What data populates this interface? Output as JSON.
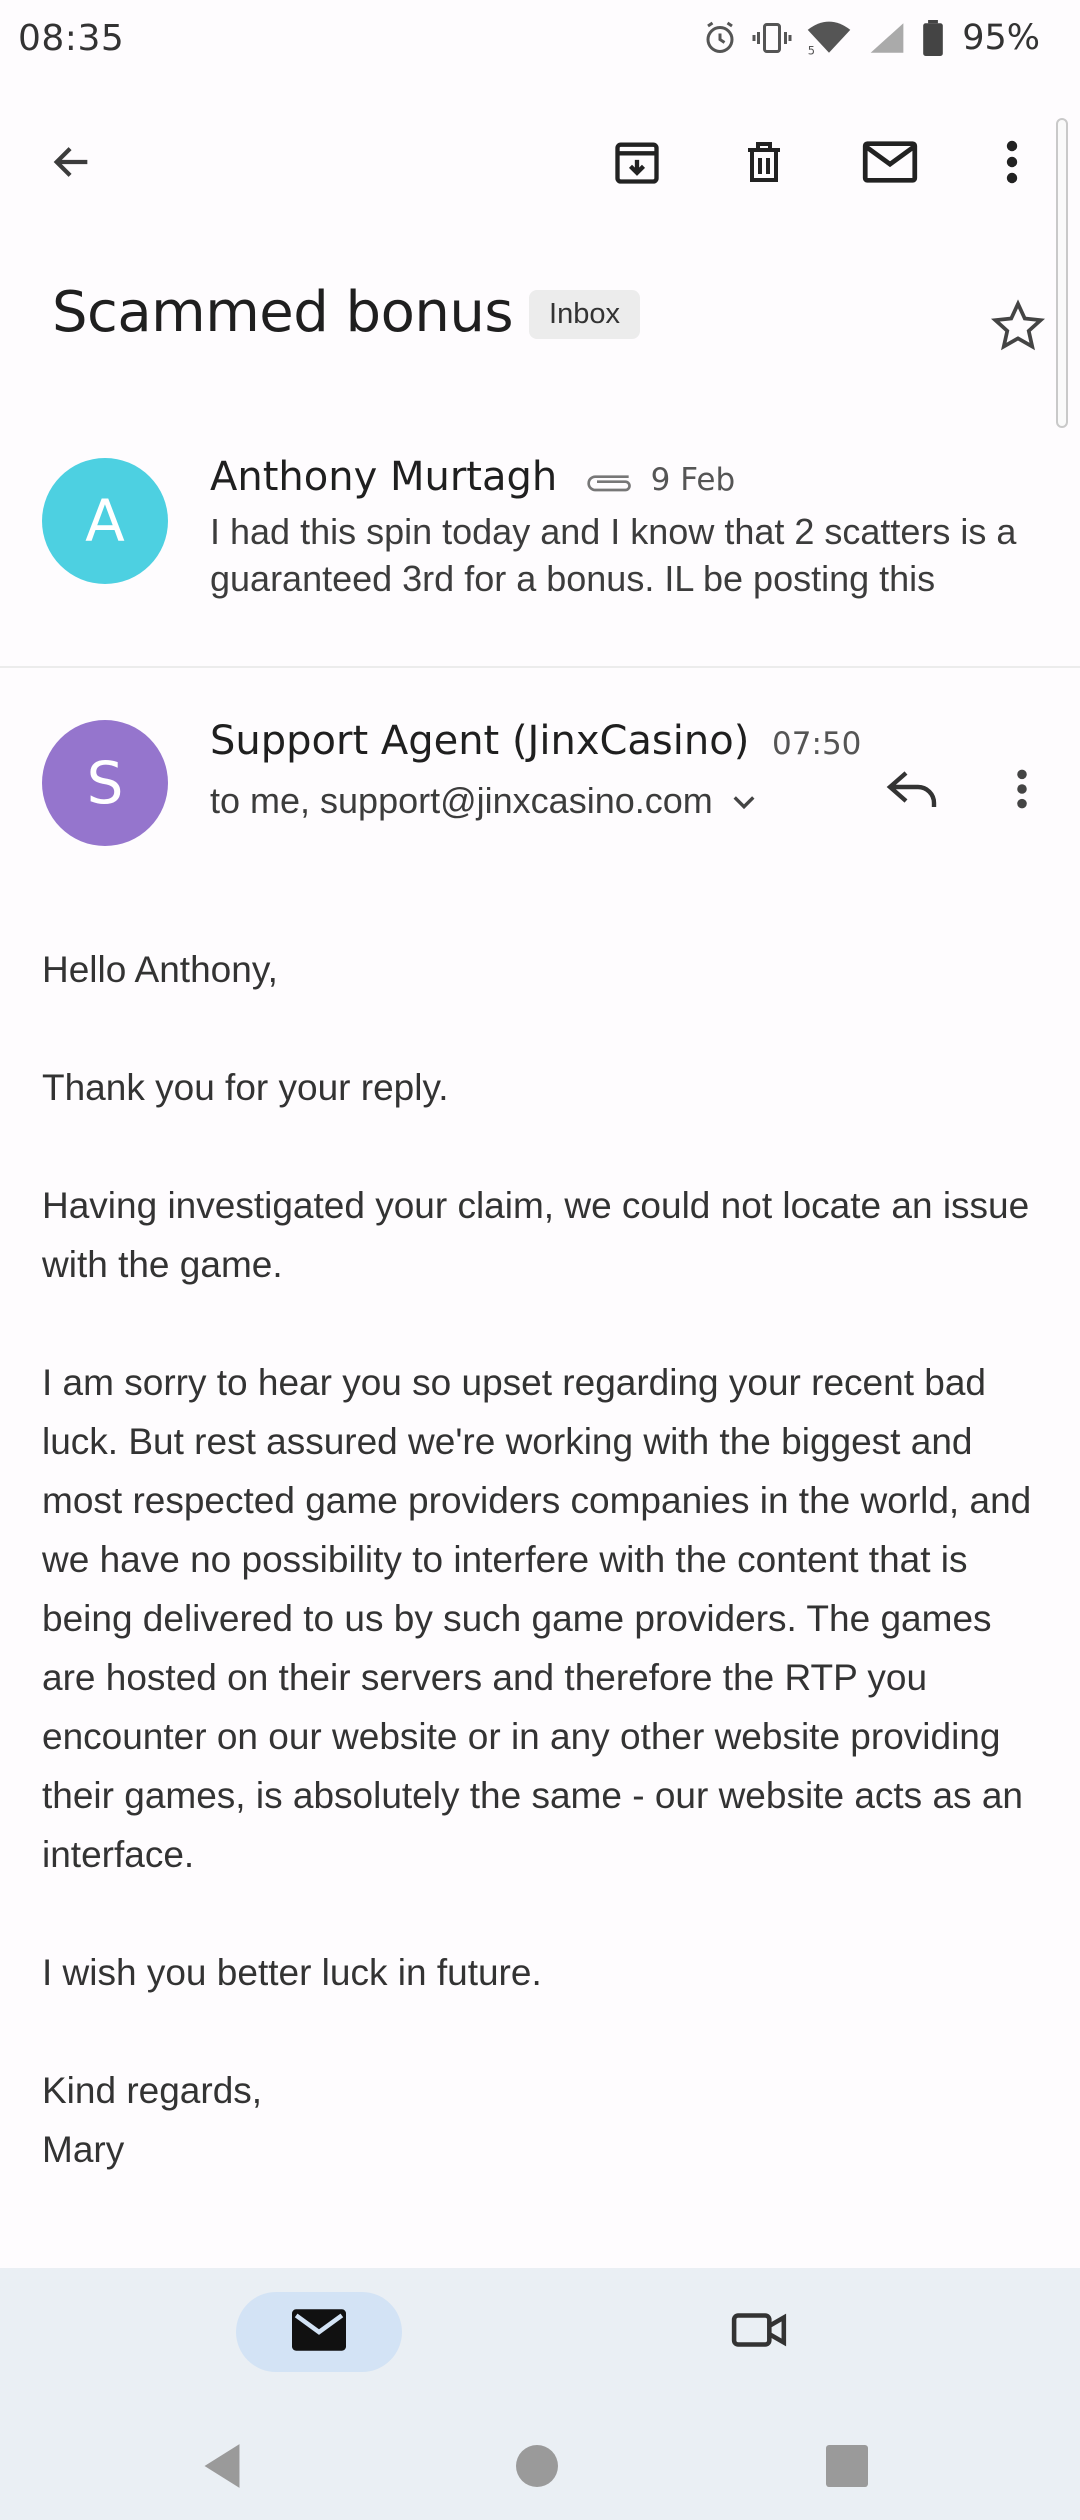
{
  "status_bar": {
    "time": "08:35",
    "battery": "95%"
  },
  "toolbar": {
    "back_icon": "arrow-left-icon",
    "archive_icon": "archive-icon",
    "delete_icon": "trash-icon",
    "mark_unread_icon": "mail-icon",
    "more_icon": "more-vert-icon"
  },
  "subject": {
    "title": "Scammed bonus",
    "label": "Inbox"
  },
  "thread": [
    {
      "avatar_letter": "A",
      "avatar_color": "#4dd0e1",
      "sender": "Anthony Murtagh",
      "date": "9 Feb",
      "snippet": "I had this spin today and I know that 2 scatters is a guaranteed 3rd for a bonus. IL be posting this"
    },
    {
      "avatar_letter": "S",
      "avatar_color": "#9575cd",
      "sender": "Support Agent (JinxCasino)",
      "time": "07:50",
      "recipients": "to me, support@jinxcasino.com"
    }
  ],
  "message_body": {
    "p1": "Hello Anthony,",
    "p2": "Thank you for your reply.",
    "p3": "Having investigated your claim, we could not locate an issue with the game.",
    "p4": "I am sorry to hear you so upset regarding your recent bad luck. But rest assured we're working with the biggest and most respected game providers companies in the world, and we have no possibility to interfere with the content that is being delivered to us by such game providers. The games are hosted on their servers and therefore the RTP you encounter on our website or in any other website providing their games, is absolutely the same - our website acts as an interface.",
    "p5": "I wish you better luck in future.",
    "p6a": "Kind regards,",
    "p6b": "Mary"
  },
  "colors": {
    "accent_pill": "#d3e3f5",
    "nav_bg": "#eaeff4"
  }
}
